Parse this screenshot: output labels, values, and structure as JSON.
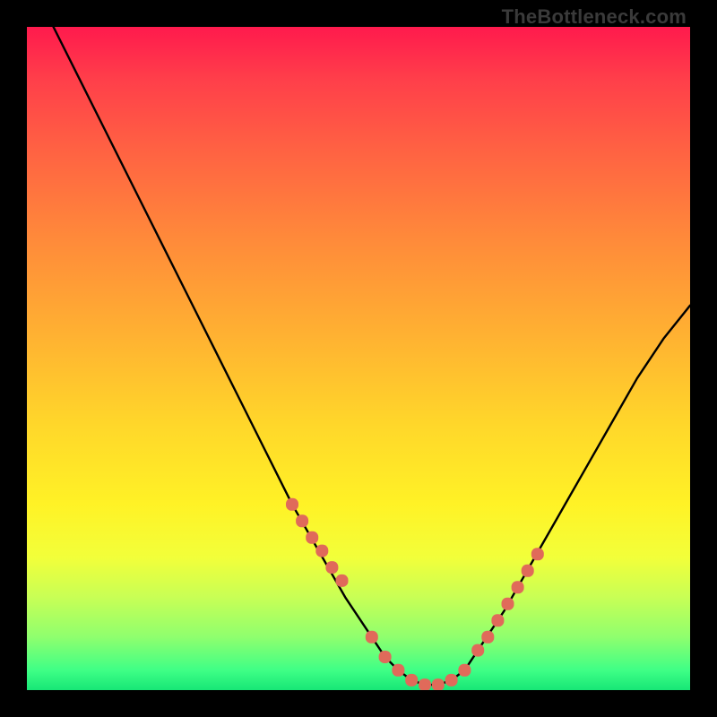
{
  "watermark": {
    "text": "TheBottleneck.com"
  },
  "colors": {
    "background": "#000000",
    "curve": "#000000",
    "marker": "#e06a5a",
    "gradient_top": "#ff1a4d",
    "gradient_bottom": "#17e676"
  },
  "chart_data": {
    "type": "line",
    "title": "",
    "xlabel": "",
    "ylabel": "",
    "xlim": [
      0,
      100
    ],
    "ylim": [
      0,
      100
    ],
    "grid": false,
    "legend": false,
    "series": [
      {
        "name": "bottleneck-curve",
        "x": [
          0,
          4,
          8,
          12,
          16,
          20,
          24,
          28,
          32,
          36,
          40,
          44,
          48,
          52,
          54,
          56,
          58,
          60,
          62,
          64,
          66,
          68,
          72,
          76,
          80,
          84,
          88,
          92,
          96,
          100
        ],
        "y": [
          108,
          100,
          92,
          84,
          76,
          68,
          60,
          52,
          44,
          36,
          28,
          21,
          14,
          8,
          5,
          3,
          1.5,
          0.8,
          0.8,
          1.5,
          3,
          6,
          12,
          19,
          26,
          33,
          40,
          47,
          53,
          58
        ]
      }
    ],
    "markers": {
      "name": "highlighted-points",
      "x": [
        40,
        41.5,
        43,
        44.5,
        46,
        47.5,
        52,
        54,
        56,
        58,
        60,
        62,
        64,
        66,
        68,
        69.5,
        71,
        72.5,
        74,
        75.5,
        77
      ],
      "y": [
        28,
        25.5,
        23,
        21,
        18.5,
        16.5,
        8,
        5,
        3,
        1.5,
        0.8,
        0.8,
        1.5,
        3,
        6,
        8,
        10.5,
        13,
        15.5,
        18,
        20.5
      ]
    }
  }
}
